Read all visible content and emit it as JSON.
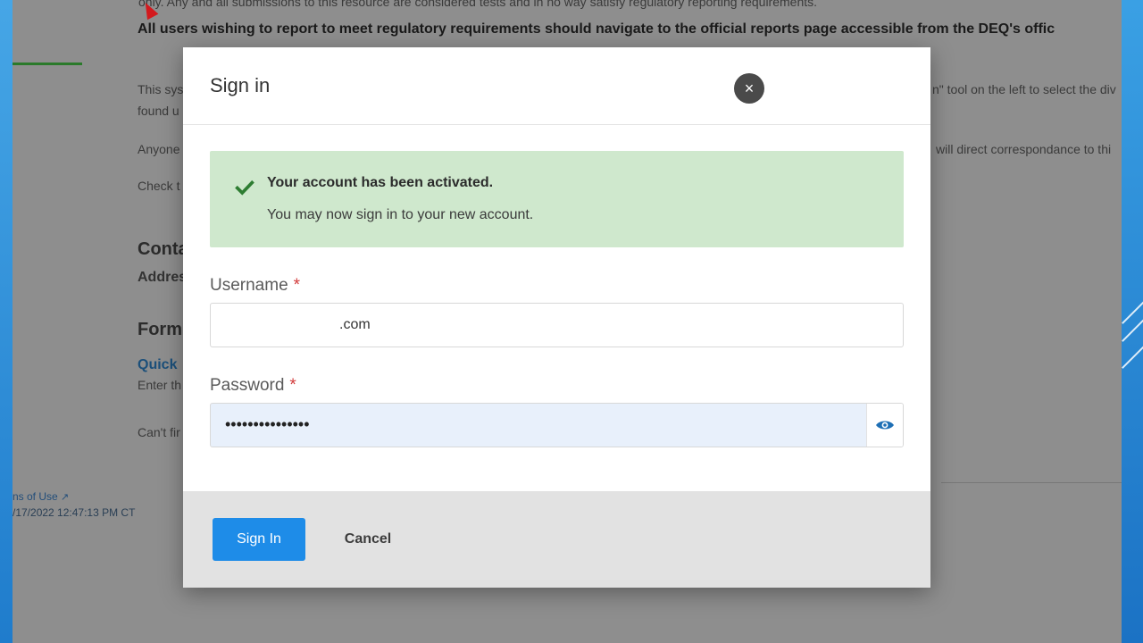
{
  "background_page": {
    "line1": "only.  Any and all submissions to this resource are considered tests and in no way satisfy regulatory reporting requirements.",
    "line2": "All users wishing to report to meet regulatory requirements should navigate to the official reports page accessible from the DEQ's offic",
    "para1_start": "This sys",
    "para1_end": "n\" tool on the left to select the div",
    "para1_line2": "found u",
    "para2_start": "Anyone",
    "para2_end": "will direct correspondance to thi",
    "para3_start": "Check t",
    "heading_contact": "Conta",
    "address_label": "Addres",
    "heading_forms": "Form",
    "quick_link": "Quick",
    "enter_text": "Enter th",
    "cant_find": "Can't fir",
    "footer_terms": "ns of Use",
    "footer_time": "/17/2022 12:47:13 PM CT"
  },
  "modal": {
    "title": "Sign in",
    "close_label": "×",
    "alert": {
      "title": "Your account has been activated.",
      "body": "You may now sign in to your new account."
    },
    "username": {
      "label": "Username",
      "required_mark": "*",
      "value": ".com"
    },
    "password": {
      "label": "Password",
      "required_mark": "*",
      "value": "•••••••••••••••"
    },
    "footer": {
      "signin_label": "Sign In",
      "cancel_label": "Cancel"
    }
  },
  "colors": {
    "primary_button": "#1e8ce8",
    "alert_bg": "#cfe8cd",
    "success_check": "#2e7d32",
    "required": "#d23b3b"
  },
  "icons": {
    "close": "close-icon",
    "check": "check-icon",
    "eye": "eye-icon",
    "external_link": "external-link-icon"
  }
}
